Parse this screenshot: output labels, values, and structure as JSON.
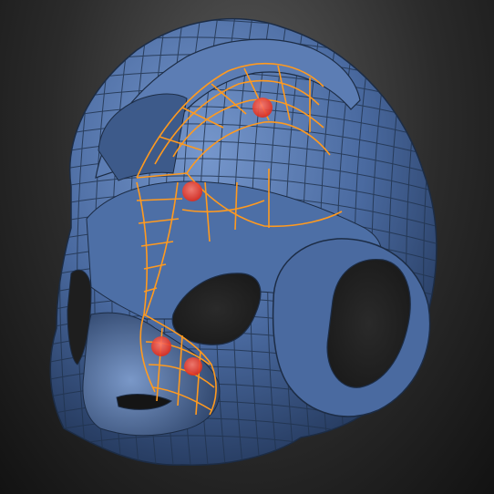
{
  "viewport": {
    "background_top": "#5a5a5a",
    "background_bottom": "#121212"
  },
  "model": {
    "subject": "helmet-mesh",
    "surface_color": "#4a6aa0",
    "surface_dark": "#2b4066",
    "surface_light": "#6f90c6",
    "wire_color": "#22344f",
    "polygroup_wire_color": "#ff9a1f",
    "marker_color": "#ff3b2a"
  },
  "markers": [
    {
      "id": "marker-1",
      "icon": "pin-icon"
    },
    {
      "id": "marker-2",
      "icon": "pin-icon"
    },
    {
      "id": "marker-3",
      "icon": "pin-icon"
    },
    {
      "id": "marker-4",
      "icon": "pin-icon"
    }
  ]
}
